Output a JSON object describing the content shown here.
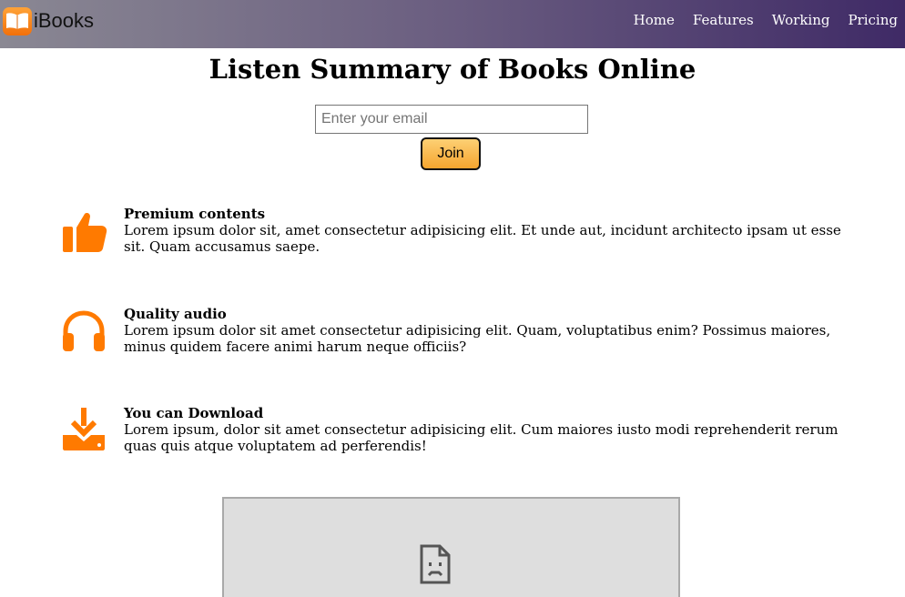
{
  "navbar": {
    "brand": "iBooks",
    "links": [
      "Home",
      "Features",
      "Working",
      "Pricing"
    ]
  },
  "hero": {
    "title": "Listen Summary of Books Online",
    "email_placeholder": "Enter your email",
    "join_label": "Join"
  },
  "features": [
    {
      "title": "Premium contents",
      "icon": "thumbs-up-icon",
      "text": "Lorem ipsum dolor sit, amet consectetur adipisicing elit. Et unde aut, incidunt architecto ipsam ut esse sit. Quam accusamus saepe."
    },
    {
      "title": "Quality audio",
      "icon": "headphones-icon",
      "text": "Lorem ipsum dolor sit amet consectetur adipisicing elit. Quam, voluptatibus enim? Possimus maiores, minus quidem facere animi harum neque officiis?"
    },
    {
      "title": "You can Download",
      "icon": "download-icon",
      "text": "Lorem ipsum, dolor sit amet consectetur adipisicing elit. Cum maiores iusto modi reprehenderit rerum quas quis atque voluptatem ad perferendis!"
    }
  ],
  "embed": {
    "icon": "broken-file-icon"
  },
  "colors": {
    "accent": "#ff7a00",
    "nav_start": "#8a8893",
    "nav_end": "#3f2a66",
    "button": "#f5a52f"
  }
}
